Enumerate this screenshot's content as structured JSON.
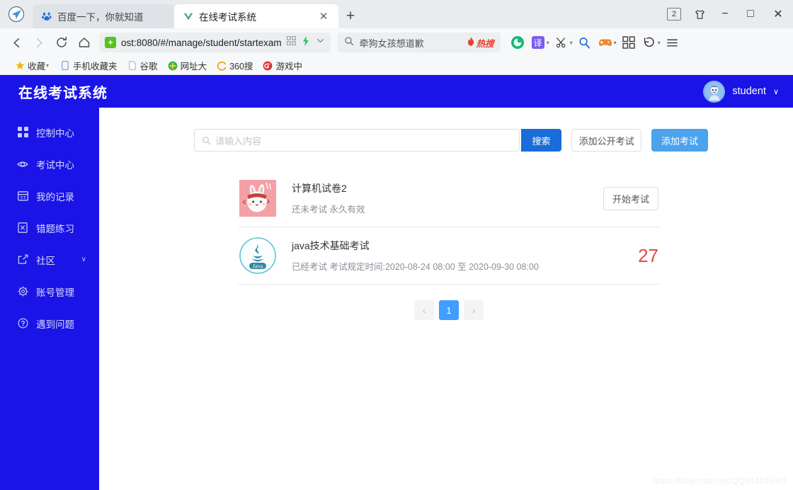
{
  "browser": {
    "logo_icon": "navigator-paper-plane-icon",
    "tabs": [
      {
        "title": "百度一下，你就知道",
        "favicon": "baidu-paw-icon",
        "active": false
      },
      {
        "title": "在线考试系统",
        "favicon": "vue-check-icon",
        "active": true
      }
    ],
    "new_tab_label": "+",
    "window": {
      "tab_count": "2",
      "skin_icon": "tshirt-skin-icon",
      "minimize": "−",
      "maximize": "□",
      "close": "✕"
    },
    "nav": {
      "back_icon": "back-arrow-icon",
      "forward_icon": "forward-arrow-icon",
      "reload_icon": "reload-icon",
      "home_icon": "home-icon"
    },
    "url": {
      "text": "ost:8080/#/manage/student/startexam",
      "security_icon": "green-shield-icon",
      "qr_icon": "qr-code-icon",
      "lightning_icon": "lightning-icon",
      "chevron_icon": "chevron-down-icon"
    },
    "search": {
      "value": "牵狗女孩想道歉",
      "icon": "magnifier-icon",
      "hot_label": "热搜",
      "hot_icon": "flame-icon"
    },
    "extensions": [
      {
        "name": "green-circle-extension-icon",
        "glyph": ""
      },
      {
        "name": "translate-extension-icon",
        "glyph": "译"
      },
      {
        "name": "scissors-screenshot-icon",
        "glyph": "✂"
      },
      {
        "name": "magnifier-tool-icon",
        "glyph": "🔍"
      },
      {
        "name": "gamepad-icon",
        "glyph": "🎮"
      },
      {
        "name": "apps-grid-icon",
        "glyph": "▦"
      },
      {
        "name": "undo-arrow-icon",
        "glyph": "↺"
      },
      {
        "name": "hamburger-menu-icon",
        "glyph": "☰"
      }
    ],
    "bookmarks": [
      {
        "label": "收藏",
        "icon": "star-icon",
        "has_caret": true
      },
      {
        "label": "手机收藏夹",
        "icon": "phone-icon",
        "has_caret": false
      },
      {
        "label": "谷歌",
        "icon": "page-icon",
        "has_caret": false
      },
      {
        "label": "网址大",
        "icon": "green-plus-icon",
        "has_caret": false
      },
      {
        "label": "360搜",
        "icon": "360-icon",
        "has_caret": false
      },
      {
        "label": "游戏中",
        "icon": "game-circle-icon",
        "has_caret": false
      }
    ]
  },
  "app": {
    "title": "在线考试系统",
    "brand_color": "#1a14e6",
    "user": {
      "name": "student",
      "avatar_icon": "user-avatar-icon",
      "caret_icon": "chevron-down-icon"
    },
    "sidebar": {
      "items": [
        {
          "label": "控制中心",
          "icon": "dashboard-grid-icon",
          "has_caret": false
        },
        {
          "label": "考试中心",
          "icon": "eye-icon",
          "has_caret": false
        },
        {
          "label": "我的记录",
          "icon": "calendar-icon",
          "has_caret": false
        },
        {
          "label": "错题练习",
          "icon": "document-error-icon",
          "has_caret": false
        },
        {
          "label": "社区",
          "icon": "community-icon",
          "has_caret": true
        },
        {
          "label": "账号管理",
          "icon": "gear-icon",
          "has_caret": false
        },
        {
          "label": "遇到问题",
          "icon": "question-circle-icon",
          "has_caret": false
        }
      ]
    },
    "toolbar": {
      "search_placeholder": "请输入内容",
      "search_value": "",
      "search_icon": "search-icon",
      "search_button": "搜索",
      "add_public_exam_button": "添加公开考试",
      "add_exam_button": "添加考试",
      "search_button_color": "#1a6dd8",
      "add_exam_button_color": "#4ba3ee"
    },
    "exams": [
      {
        "name": "计算机试卷2",
        "meta": "还未考试 永久有效",
        "thumb_icon": "rabbit-avatar-thumb",
        "action_type": "button",
        "action_label": "开始考试",
        "score": ""
      },
      {
        "name": "java技术基础考试",
        "meta": "已经考试 考试规定时间:2020-08-24 08:00 至 2020-09-30 08:00",
        "thumb_icon": "java-logo-thumb",
        "action_type": "score",
        "action_label": "",
        "score": "27"
      }
    ],
    "pagination": {
      "prev_icon": "chevron-left-icon",
      "next_icon": "chevron-right-icon",
      "current_page": "1",
      "active_color": "#409eff"
    },
    "watermark": "https://blog.csdn.net/QQ344245001"
  }
}
